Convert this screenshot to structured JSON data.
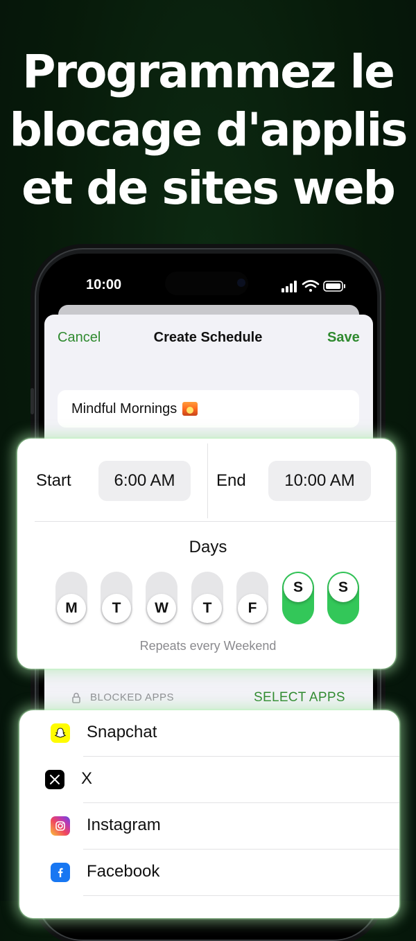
{
  "headline": {
    "lines": [
      "Programmez le",
      "blocage d'applis",
      "et de sites web"
    ]
  },
  "status_bar": {
    "time": "10:00"
  },
  "nav": {
    "cancel": "Cancel",
    "title": "Create Schedule",
    "save": "Save"
  },
  "schedule_name": "Mindful Mornings",
  "schedule_emoji": "sunrise-emoji-icon",
  "time_range": {
    "start_label": "Start",
    "start_value": "6:00 AM",
    "end_label": "End",
    "end_value": "10:00 AM"
  },
  "days": {
    "title": "Days",
    "items": [
      {
        "letter": "M",
        "on": false
      },
      {
        "letter": "T",
        "on": false
      },
      {
        "letter": "W",
        "on": false
      },
      {
        "letter": "T",
        "on": false
      },
      {
        "letter": "F",
        "on": false
      },
      {
        "letter": "S",
        "on": true
      },
      {
        "letter": "S",
        "on": true
      }
    ],
    "repeats_text": "Repeats every Weekend"
  },
  "blocked_apps": {
    "label": "BLOCKED APPS",
    "action": "SELECT APPS",
    "apps": [
      {
        "name": "Snapchat",
        "icon": "snapchat-icon"
      },
      {
        "name": "X",
        "icon": "x-icon"
      },
      {
        "name": "Instagram",
        "icon": "instagram-icon"
      },
      {
        "name": "Facebook",
        "icon": "facebook-icon"
      }
    ]
  },
  "colors": {
    "accent_green": "#2f8a2f",
    "toggle_on": "#33c759",
    "background": "#071a0a"
  }
}
